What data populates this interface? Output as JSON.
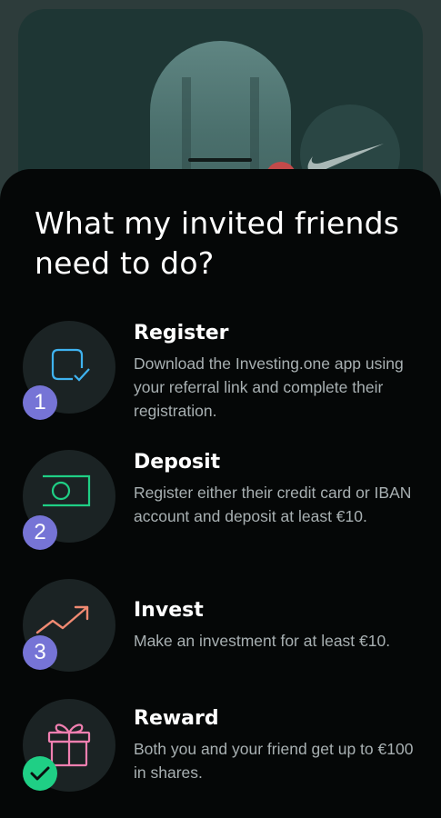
{
  "title": "What my invited friends need to do?",
  "steps": [
    {
      "name": "Register",
      "description": "Download the Investing.one app using your referral link and complete their registration.",
      "badge": "1",
      "icon": "checklist-icon",
      "color": "#3fb3f0"
    },
    {
      "name": "Deposit",
      "description": "Register either their credit card or IBAN account and deposit at least €10.",
      "badge": "2",
      "icon": "banknote-icon",
      "color": "#1fcf85"
    },
    {
      "name": "Invest",
      "description": "Make an investment for at least €10.",
      "badge": "3",
      "icon": "trending-up-icon",
      "color": "#f08a72"
    },
    {
      "name": "Reward",
      "description": "Both you and your friend get up to €100 in shares.",
      "badge": "check",
      "icon": "gift-icon",
      "color": "#f07fb0"
    }
  ],
  "colors": {
    "sheet": "#050707",
    "badge_purple": "#7674d6",
    "badge_green": "#1fcf85"
  }
}
